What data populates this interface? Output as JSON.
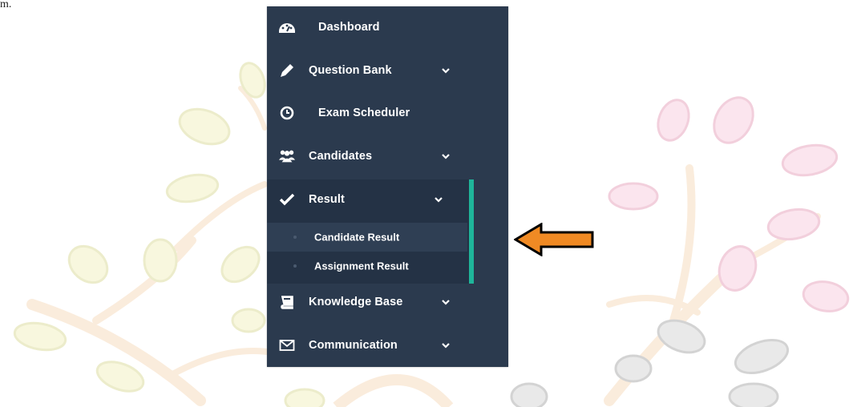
{
  "corner_text": "m.",
  "sidebar": {
    "items": [
      {
        "key": "dashboard",
        "label": "Dashboard",
        "icon": "dashboard-icon",
        "has_submenu": false
      },
      {
        "key": "question-bank",
        "label": "Question Bank",
        "icon": "pencil-icon",
        "has_submenu": true
      },
      {
        "key": "exam-scheduler",
        "label": "Exam Scheduler",
        "icon": "clock-icon",
        "has_submenu": false
      },
      {
        "key": "candidates",
        "label": "Candidates",
        "icon": "users-icon",
        "has_submenu": true
      },
      {
        "key": "result",
        "label": "Result",
        "icon": "check-icon",
        "has_submenu": true,
        "expanded": true,
        "subitems": [
          {
            "key": "candidate-result",
            "label": "Candidate Result",
            "selected": true
          },
          {
            "key": "assignment-result",
            "label": "Assignment Result",
            "selected": false
          }
        ]
      },
      {
        "key": "knowledge-base",
        "label": "Knowledge Base",
        "icon": "book-icon",
        "has_submenu": true
      },
      {
        "key": "communication",
        "label": "Communication",
        "icon": "envelope-icon",
        "has_submenu": true
      }
    ]
  },
  "colors": {
    "sidebar_bg": "#2b3a4e",
    "active_bar": "#1fb59a",
    "arrow_fill": "#f08a24",
    "text": "#ffffff"
  },
  "annotation": {
    "arrow_icon": "left-arrow-icon"
  }
}
